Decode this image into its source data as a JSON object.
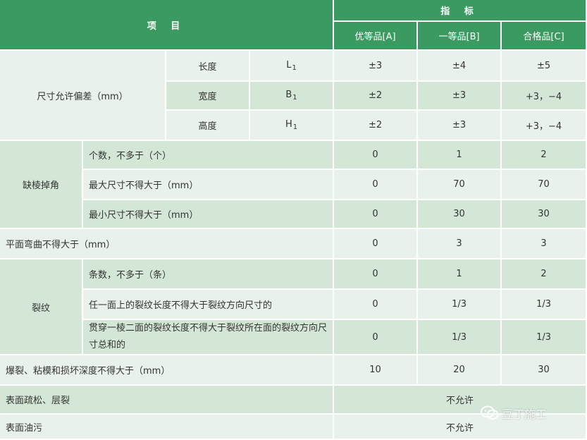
{
  "header": {
    "item_title": "项 目",
    "index_title": "指 标",
    "grades": [
      "优等品[A]",
      "一等品[B]",
      "合格品[C]"
    ]
  },
  "dimension": {
    "label": "尺寸允许偏差（mm）",
    "rows": [
      {
        "name": "长度",
        "symbol": "L",
        "sub": "1",
        "a": "±3",
        "b": "±4",
        "c": "±5"
      },
      {
        "name": "宽度",
        "symbol": "B",
        "sub": "1",
        "a": "±2",
        "b": "±3",
        "c": "+3，−4"
      },
      {
        "name": "高度",
        "symbol": "H",
        "sub": "1",
        "a": "±2",
        "b": "±3",
        "c": "+3，−4"
      }
    ]
  },
  "corner_defect": {
    "label": "缺棱掉角",
    "rows": [
      {
        "name": "个数，不多于（个）",
        "a": "0",
        "b": "1",
        "c": "2"
      },
      {
        "name": "最大尺寸不得大于（mm）",
        "a": "0",
        "b": "70",
        "c": "70"
      },
      {
        "name": "最小尺寸不得大于（mm）",
        "a": "0",
        "b": "30",
        "c": "30"
      }
    ]
  },
  "bending": {
    "label": "平面弯曲不得大于（mm）",
    "a": "0",
    "b": "3",
    "c": "3"
  },
  "crack": {
    "label": "裂纹",
    "rows": [
      {
        "name": "条数，不多于（条）",
        "a": "0",
        "b": "1",
        "c": "2"
      },
      {
        "name": "任一面上的裂纹长度不得大于裂纹方向尺寸的",
        "a": "0",
        "b": "1/3",
        "c": "1/3"
      },
      {
        "name": "贯穿一棱二面的裂纹长度不得大于裂纹所在面的裂纹方向尺寸总和的",
        "a": "0",
        "b": "1/3",
        "c": "1/3"
      }
    ]
  },
  "burst": {
    "label": "爆裂、粘模和损坏深度不得大于（mm）",
    "a": "10",
    "b": "20",
    "c": "30"
  },
  "loose": {
    "label": "表面疏松、层裂",
    "value": "不允许"
  },
  "oil": {
    "label": "表面油污",
    "value": "不允许"
  },
  "watermark": {
    "text": "豆丁施工",
    "icon": "wechat-icon"
  }
}
